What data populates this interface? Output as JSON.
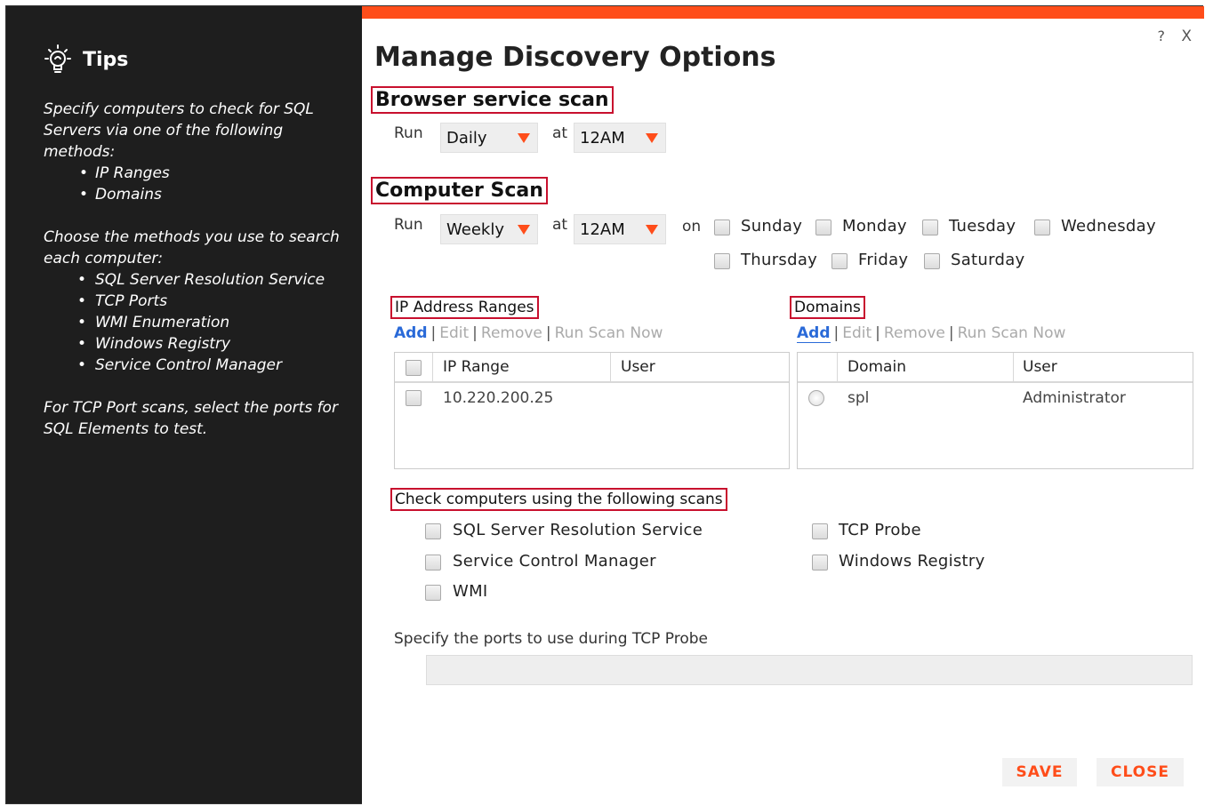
{
  "tips": {
    "title": "Tips",
    "para1": "Specify computers to check for SQL Servers via one of the following methods:",
    "methods": [
      "IP Ranges",
      "Domains"
    ],
    "para2": "Choose the methods you use to search each computer:",
    "search_methods": [
      "SQL Server Resolution Service",
      "TCP Ports",
      "WMI Enumeration",
      "Windows Registry",
      "Service Control Manager"
    ],
    "para3": "For TCP Port scans, select the ports for SQL Elements to test."
  },
  "dialog": {
    "title": "Manage Discovery Options",
    "help": "?",
    "close": "X"
  },
  "browser_scan": {
    "heading": "Browser service scan",
    "run_label": "Run",
    "frequency": "Daily",
    "at_label": "at",
    "time": "12AM"
  },
  "computer_scan": {
    "heading": "Computer Scan",
    "run_label": "Run",
    "frequency": "Weekly",
    "at_label": "at",
    "time": "12AM",
    "on_label": "on",
    "days": [
      "Sunday",
      "Monday",
      "Tuesday",
      "Wednesday",
      "Thursday",
      "Friday",
      "Saturday"
    ]
  },
  "ip_ranges": {
    "heading": "IP Address Ranges",
    "actions": [
      "Add",
      "Edit",
      "Remove",
      "Run Scan Now"
    ],
    "columns": [
      "IP Range",
      "User"
    ],
    "rows": [
      {
        "range": "10.220.200.25",
        "user": ""
      }
    ]
  },
  "domains": {
    "heading": "Domains",
    "actions": [
      "Add",
      "Edit",
      "Remove",
      "Run Scan Now"
    ],
    "columns": [
      "Domain",
      "User"
    ],
    "rows": [
      {
        "domain": "spl",
        "user": "Administrator"
      }
    ]
  },
  "scans": {
    "heading": "Check computers using the following scans",
    "options": [
      "SQL Server Resolution Service",
      "Service Control Manager",
      "WMI",
      "TCP Probe",
      "Windows Registry"
    ]
  },
  "ports": {
    "label": "Specify the ports to use during TCP Probe",
    "value": ""
  },
  "buttons": {
    "save": "SAVE",
    "close": "CLOSE"
  },
  "colors": {
    "accent": "#ff4d1a",
    "highlight_box": "#c8102e",
    "link": "#2a6ad8",
    "tips_bg": "#1e1e1e"
  }
}
